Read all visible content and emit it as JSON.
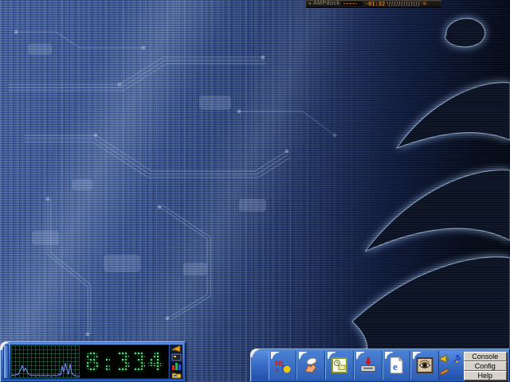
{
  "amp_bar": {
    "title": "AMPdock",
    "collapse_glyph": "◂",
    "eq_glyph": "≡",
    "time": "-01:32",
    "accent_color": "#ff9d2e"
  },
  "monitor": {
    "led_text": "8:334",
    "led_color": "#43ef7c",
    "graph": {
      "type": "line",
      "values": [
        2,
        3,
        2,
        4,
        3,
        6,
        10,
        15,
        8,
        12,
        7,
        4,
        3,
        2,
        3,
        2,
        2,
        3,
        2,
        2,
        3,
        2,
        2,
        3,
        2,
        2,
        2,
        3,
        2,
        2,
        4,
        3,
        14,
        7,
        18,
        10,
        4,
        17,
        6,
        3,
        2,
        2,
        1,
        2
      ],
      "line_color": "#5a6af5",
      "grid_color": "#1c5640"
    },
    "icons": [
      {
        "name": "megaphone"
      },
      {
        "name": "screen"
      },
      {
        "name": "chart"
      },
      {
        "name": "folder"
      }
    ]
  },
  "dock": {
    "launchers": [
      {
        "name": "m-media",
        "glyph_top": "m",
        "glyph_bottom": "e"
      },
      {
        "name": "hand-tool"
      },
      {
        "name": "organizer"
      },
      {
        "name": "inbox-download"
      },
      {
        "name": "internet-document",
        "glyph": "e"
      },
      {
        "name": "image-viewer"
      }
    ],
    "tray": [
      {
        "name": "volume"
      },
      {
        "name": "runner"
      },
      {
        "name": "notes"
      }
    ],
    "buttons": [
      {
        "label": "Console"
      },
      {
        "label": "Config"
      },
      {
        "label": "Help"
      }
    ]
  },
  "wallpaper": {
    "base_color": "#3f5fa8",
    "dark_color": "#060c1c",
    "swirl_color": "#0c1426",
    "glow_color": "#8fb2e0",
    "trace_color": "#a9c2ea"
  }
}
